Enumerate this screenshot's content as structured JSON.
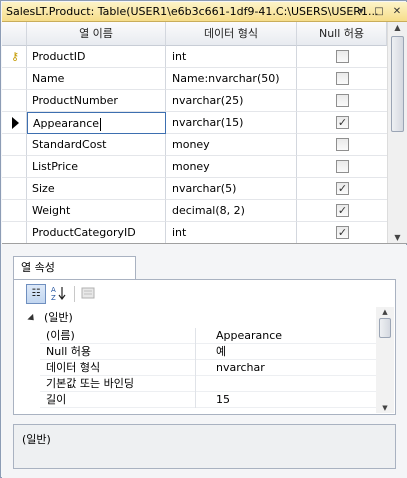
{
  "window": {
    "title": "SalesLT.Product: Table(USER1\\e6b3c661-1df9-41.C:\\USERS\\USER1...",
    "pin_glyph": "▾",
    "restore_glyph": "□",
    "close_glyph": "✕"
  },
  "grid": {
    "headers": {
      "column_name": "열 이름",
      "data_type": "데이터 형식",
      "allow_nulls": "Null 허용"
    },
    "rows": [
      {
        "name": "ProductID",
        "type": "int",
        "allow_null": false,
        "primary_key": true
      },
      {
        "name": "Name",
        "type": "Name:nvarchar(50)",
        "allow_null": false
      },
      {
        "name": "ProductNumber",
        "type": "nvarchar(25)",
        "allow_null": false
      },
      {
        "name": "Appearance",
        "type": "nvarchar(15)",
        "allow_null": true,
        "current": true
      },
      {
        "name": "StandardCost",
        "type": "money",
        "allow_null": false
      },
      {
        "name": "ListPrice",
        "type": "money",
        "allow_null": false
      },
      {
        "name": "Size",
        "type": "nvarchar(5)",
        "allow_null": true
      },
      {
        "name": "Weight",
        "type": "decimal(8, 2)",
        "allow_null": true
      },
      {
        "name": "ProductCategoryID",
        "type": "int",
        "allow_null": true
      }
    ]
  },
  "properties": {
    "tab_label": "열 속성",
    "category": "(일반)",
    "rows": [
      {
        "name": "(이름)",
        "value": "Appearance"
      },
      {
        "name": "Null 허용",
        "value": "예"
      },
      {
        "name": "데이터 형식",
        "value": "nvarchar"
      },
      {
        "name": "기본값 또는 바인딩",
        "value": ""
      },
      {
        "name": "길이",
        "value": "15"
      }
    ],
    "description": "(일반)"
  },
  "colors": {
    "title_bar": "#f6dd8a",
    "checkbox_border": "#8f8f8f",
    "selection_border": "#3d6fb0"
  }
}
